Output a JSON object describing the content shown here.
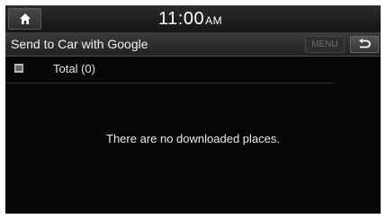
{
  "status_bar": {
    "home_icon": "home-icon",
    "time": "11:00",
    "ampm": "AM"
  },
  "title_bar": {
    "title": "Send to Car with Google",
    "menu_label": "MENU",
    "back_icon": "back-arrow-icon"
  },
  "list_header": {
    "icon": "list-icon",
    "total_label": "Total (0)"
  },
  "content": {
    "empty_message": "There are no downloaded places."
  },
  "colors": {
    "background": "#070707",
    "text": "#eaeaea",
    "menu_disabled_text": "#6c6c6c"
  }
}
